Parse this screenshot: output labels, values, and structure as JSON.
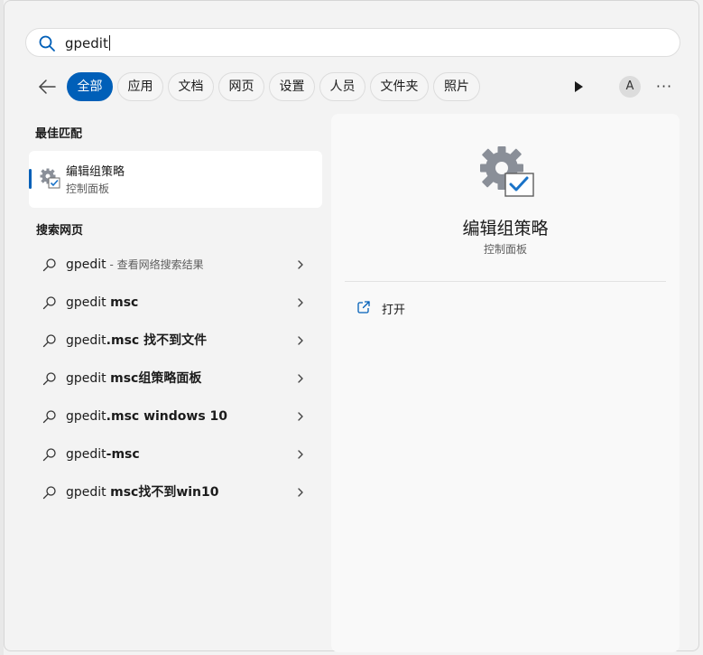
{
  "search": {
    "query": "gpedit"
  },
  "filters": {
    "tabs": [
      {
        "label": "全部",
        "active": true
      },
      {
        "label": "应用"
      },
      {
        "label": "文档"
      },
      {
        "label": "网页"
      },
      {
        "label": "设置"
      },
      {
        "label": "人员"
      },
      {
        "label": "文件夹"
      },
      {
        "label": "照片"
      }
    ],
    "avatar_letter": "A",
    "more_label": "···"
  },
  "best_match": {
    "section_title": "最佳匹配",
    "title": "编辑组策略",
    "subtitle": "控制面板"
  },
  "web": {
    "section_title": "搜索网页",
    "items": [
      {
        "plain": "gpedit",
        "bold": "",
        "suffix": " - 查看网络搜索结果"
      },
      {
        "plain": "gpedit ",
        "bold": "msc",
        "suffix": ""
      },
      {
        "plain": "gpedit",
        "bold": ".msc 找不到文件",
        "suffix": ""
      },
      {
        "plain": "gpedit ",
        "bold": "msc组策略面板",
        "suffix": ""
      },
      {
        "plain": "gpedit",
        "bold": ".msc windows 10",
        "suffix": ""
      },
      {
        "plain": "gpedit",
        "bold": "-msc",
        "suffix": ""
      },
      {
        "plain": "gpedit ",
        "bold": "msc找不到win10",
        "suffix": ""
      }
    ]
  },
  "detail": {
    "title": "编辑组策略",
    "subtitle": "控制面板",
    "actions": [
      {
        "label": "打开",
        "icon": "open-external-icon"
      }
    ]
  },
  "colors": {
    "accent": "#005fb8",
    "pane": "#f9f9f9",
    "background": "#f3f3f3"
  }
}
